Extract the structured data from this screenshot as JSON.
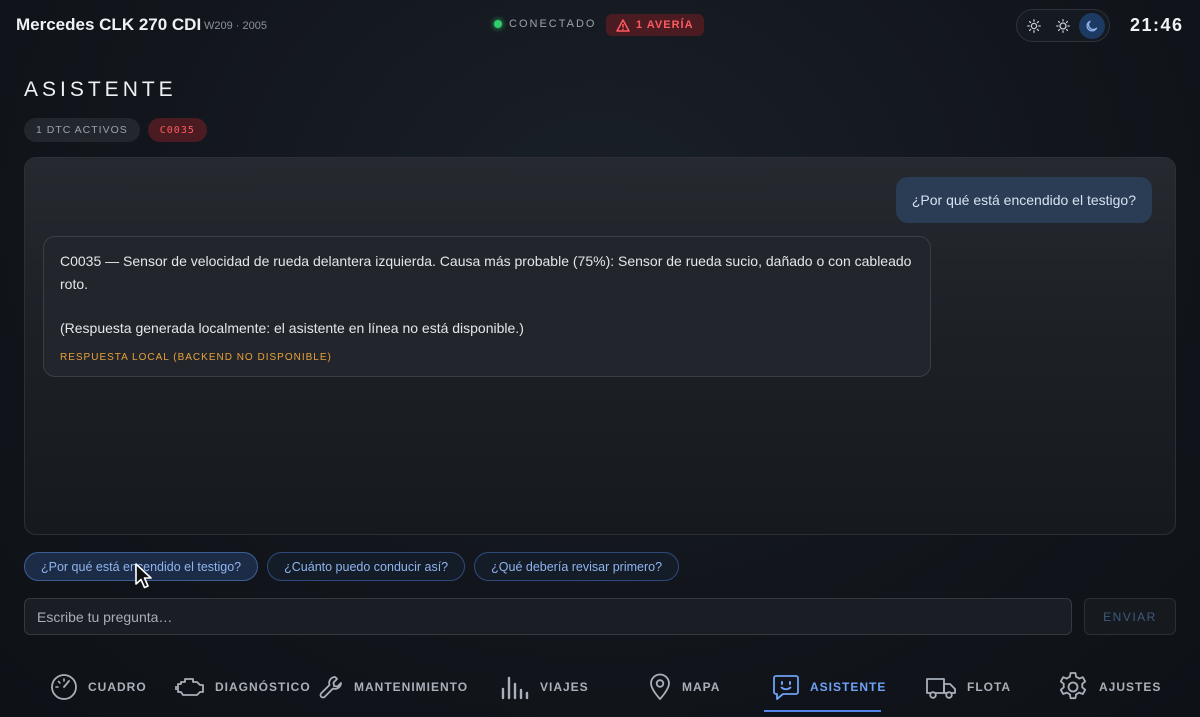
{
  "header": {
    "car_title": "Mercedes CLK 270 CDI",
    "car_subtitle": "W209 · 2005",
    "connection_status": "CONECTADO",
    "fault_badge": "1 AVERÍA",
    "clock": "21:46",
    "theme_options": [
      "sun-icon",
      "brightness-icon",
      "moon-icon"
    ],
    "active_theme": "moon-icon"
  },
  "page": {
    "title": "ASISTENTE",
    "dtc_count_chip": "1 DTC ACTIVOS",
    "dtc_code_chip": "C0035"
  },
  "chat": {
    "user_message": "¿Por qué está encendido el testigo?",
    "bot_message_line1": "C0035 — Sensor de velocidad de rueda delantera izquierda. Causa más probable (75%): Sensor de rueda sucio, dañado o con cableado roto.",
    "bot_message_line2": "(Respuesta generada localmente: el asistente en línea no está disponible.)",
    "bot_note": "RESPUESTA LOCAL (BACKEND NO DISPONIBLE)"
  },
  "suggestions": [
    "¿Por qué está encendido el testigo?",
    "¿Cuánto puedo conducir así?",
    "¿Qué debería revisar primero?"
  ],
  "input": {
    "placeholder": "Escribe tu pregunta…",
    "value": "",
    "send_label": "ENVIAR"
  },
  "nav": {
    "items": [
      {
        "label": "CUADRO",
        "icon": "gauge-icon"
      },
      {
        "label": "DIAGNÓSTICO",
        "icon": "engine-icon"
      },
      {
        "label": "MANTENIMIENTO",
        "icon": "wrench-icon"
      },
      {
        "label": "VIAJES",
        "icon": "bar-chart-icon"
      },
      {
        "label": "MAPA",
        "icon": "map-pin-icon"
      },
      {
        "label": "ASISTENTE",
        "icon": "chat-bot-icon"
      },
      {
        "label": "FLOTA",
        "icon": "truck-icon"
      },
      {
        "label": "AJUSTES",
        "icon": "gear-icon"
      }
    ],
    "active": "ASISTENTE"
  },
  "colors": {
    "accent": "#4f86e8",
    "danger": "#ff5a60",
    "warning": "#e8a13a",
    "connected": "#2fce6a"
  }
}
